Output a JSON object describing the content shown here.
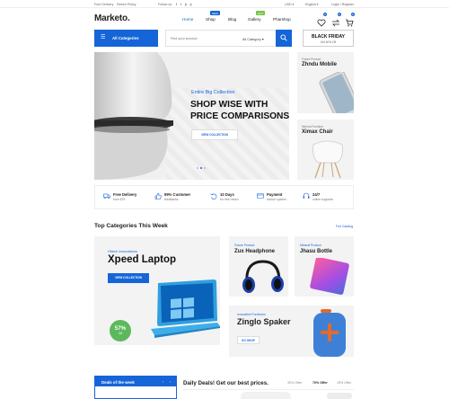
{
  "topbar": {
    "free_delivery": "Free Delivery",
    "return_policy": "Return Policy",
    "follow_us": "Follow us",
    "social_icons": [
      "facebook-icon",
      "twitter-icon",
      "pinterest-icon",
      "instagram-icon"
    ],
    "currency": "USD",
    "language": "English",
    "account": "Login / Register"
  },
  "header": {
    "logo": "Marketo.",
    "nav": [
      {
        "label": "Home",
        "badge": ""
      },
      {
        "label": "Shop",
        "badge": "NEW",
        "badge_color": "#1565d8"
      },
      {
        "label": "Blog",
        "badge": ""
      },
      {
        "label": "Gallery",
        "badge": "HOT",
        "badge_color": "#5cb85c"
      },
      {
        "label": "Pharshop",
        "badge": ""
      }
    ],
    "wishlist_count": "0",
    "compare_count": "0",
    "cart_count": "0"
  },
  "search": {
    "categories_label": "All Categories",
    "placeholder": "Find your product",
    "category_select": "All Category",
    "promo_title": "BLACK FRIDAY",
    "promo_sub": "Get 40% Off"
  },
  "hero": {
    "kicker": "Entire Big Collection",
    "title_line1": "SHOP WISE WITH",
    "title_line2": "PRICE COMPARISONS",
    "button": "VIEW COLLECTION",
    "slide_count": 3,
    "active_slide": 1
  },
  "side_cards": [
    {
      "kicker": "Future Product",
      "title": "Zhndu Mobile"
    },
    {
      "kicker": "Mineral Furniture",
      "title": "Ximax Chair"
    }
  ],
  "features": [
    {
      "title": "Free Delivery",
      "sub": "from $75",
      "icon": "truck-icon"
    },
    {
      "title": "99% Customer",
      "sub": "feedbacks",
      "icon": "thumbs-up-icon"
    },
    {
      "title": "10 Days",
      "sub": "for free return",
      "icon": "return-icon"
    },
    {
      "title": "Payment",
      "sub": "secure system",
      "icon": "card-icon"
    },
    {
      "title": "24/7",
      "sub": "online supports",
      "icon": "headset-icon"
    }
  ],
  "categories_section": {
    "title": "Top Categories This Week",
    "link": "Full Catalog",
    "big": {
      "kicker": "Hitech Innovations",
      "title": "Xpeed Laptop",
      "button": "VIEW COLLECTION",
      "badge_pct": "57%",
      "badge_label": "Off"
    },
    "small": [
      {
        "kicker": "Future Product",
        "title": "Zux Headphone"
      },
      {
        "kicker": "Mineral Product",
        "title": "Jhasu Bottle"
      }
    ],
    "wide": {
      "kicker": "Innovative Furnitures",
      "title": "Zinglo Spaker",
      "button": "GO SHOP"
    }
  },
  "bottom": {
    "deals_label": "Deals of the week",
    "daily_title": "Daily Deals! Get our best prices.",
    "tabs": [
      "30% Offer",
      "70% Offer",
      "15% Offer"
    ],
    "active_tab": 1
  },
  "colors": {
    "accent": "#1565d8",
    "green": "#5cb85c",
    "badge_green": "#7ac143"
  }
}
